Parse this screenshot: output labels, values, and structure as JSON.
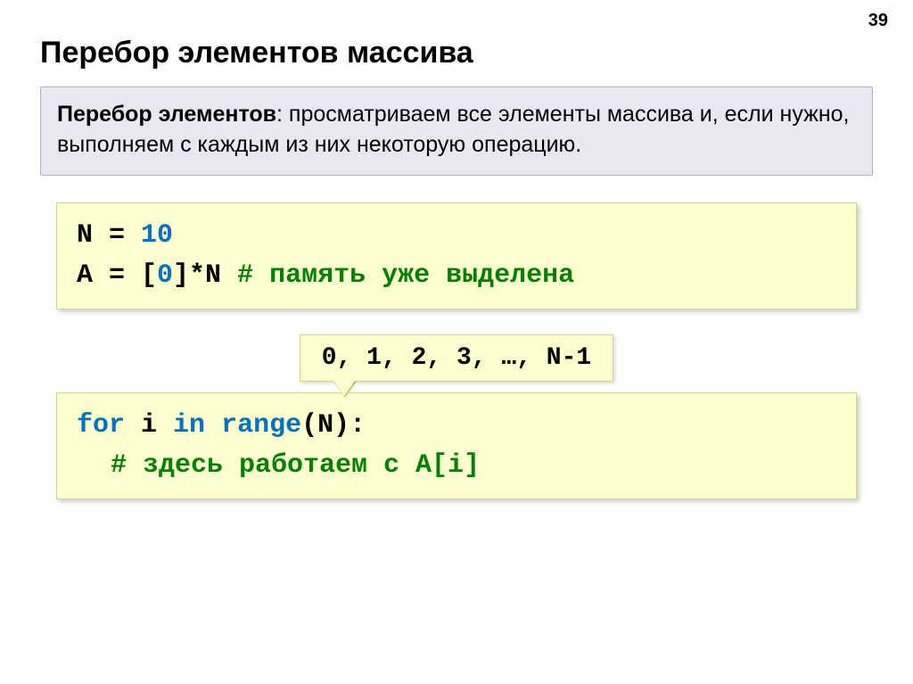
{
  "page_number": "39",
  "title": "Перебор элементов массива",
  "definition": {
    "term": "Перебор элементов",
    "text_after_term": ": просматриваем все элементы массива и, если нужно, выполняем с каждым из них некоторую операцию."
  },
  "code1": {
    "line1_lhs": "N",
    "line1_eq": " = ",
    "line1_rhs": "10",
    "line2_lhs": "A",
    "line2_eq": " = [",
    "line2_zero": "0",
    "line2_after": "]*N   ",
    "line2_comment": "# память уже выделена"
  },
  "callout": "0, 1, 2, 3, …, N-1",
  "code2": {
    "kw_for": "for",
    "mid1": " i ",
    "kw_in": "in",
    "mid2": " ",
    "kw_range": "range",
    "tail": "(N):",
    "comment": "# здесь работаем с A[i]"
  }
}
